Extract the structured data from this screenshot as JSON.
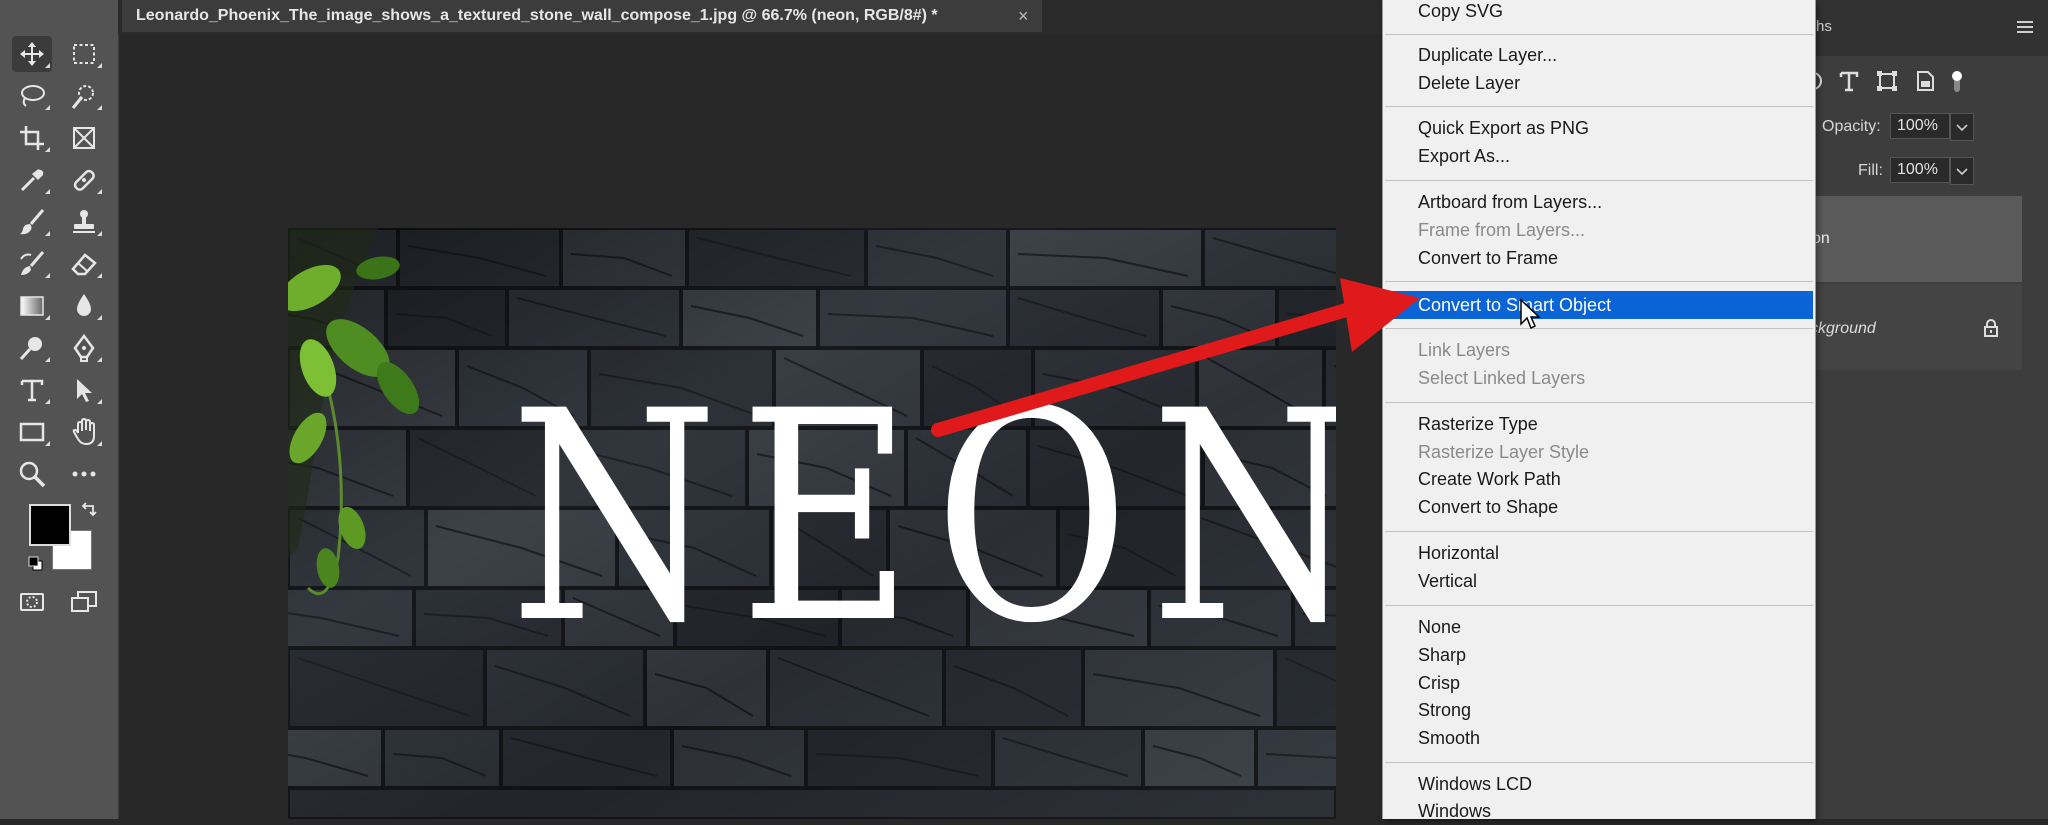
{
  "document": {
    "title": "Leonardo_Phoenix_The_image_shows_a_textured_stone_wall_compose_1.jpg @ 66.7% (neon, RGB/8#) *",
    "close_glyph": "×"
  },
  "canvas": {
    "text": "NEON"
  },
  "tools": [
    {
      "name": "move-tool-icon"
    },
    {
      "name": "marquee-tool-icon"
    },
    {
      "name": "lasso-tool-icon"
    },
    {
      "name": "quick-selection-tool-icon"
    },
    {
      "name": "crop-tool-icon"
    },
    {
      "name": "frame-tool-icon"
    },
    {
      "name": "eyedropper-tool-icon"
    },
    {
      "name": "healing-brush-tool-icon"
    },
    {
      "name": "brush-tool-icon"
    },
    {
      "name": "stamp-tool-icon"
    },
    {
      "name": "history-brush-tool-icon"
    },
    {
      "name": "eraser-tool-icon"
    },
    {
      "name": "gradient-tool-icon"
    },
    {
      "name": "blur-tool-icon"
    },
    {
      "name": "dodge-tool-icon"
    },
    {
      "name": "pen-tool-icon"
    },
    {
      "name": "type-tool-icon"
    },
    {
      "name": "path-selection-tool-icon"
    },
    {
      "name": "rectangle-tool-icon"
    },
    {
      "name": "hand-tool-icon"
    },
    {
      "name": "zoom-tool-icon"
    },
    {
      "name": "more-tools-icon"
    },
    {
      "name": "quick-mask-icon"
    },
    {
      "name": "screen-mode-icon"
    }
  ],
  "colors": {
    "foreground": "#000000",
    "background": "#ffffff",
    "menu_highlight": "#0a64d6",
    "arrow": "#e0191b"
  },
  "context_menu": {
    "items": [
      {
        "label": "Copy SVG",
        "disabled": false
      },
      {
        "label": "Duplicate Layer...",
        "disabled": false
      },
      {
        "label": "Delete Layer",
        "disabled": false
      },
      {
        "label": "Quick Export as PNG",
        "disabled": false
      },
      {
        "label": "Export As...",
        "disabled": false
      },
      {
        "label": "Artboard from Layers...",
        "disabled": false
      },
      {
        "label": "Frame from Layers...",
        "disabled": true
      },
      {
        "label": "Convert to Frame",
        "disabled": false
      },
      {
        "label": "Convert to Smart Object",
        "disabled": false,
        "highlighted": true
      },
      {
        "label": "Link Layers",
        "disabled": true
      },
      {
        "label": "Select Linked Layers",
        "disabled": true
      },
      {
        "label": "Rasterize Type",
        "disabled": false
      },
      {
        "label": "Rasterize Layer Style",
        "disabled": true
      },
      {
        "label": "Create Work Path",
        "disabled": false
      },
      {
        "label": "Convert to Shape",
        "disabled": false
      },
      {
        "label": "Horizontal",
        "disabled": false
      },
      {
        "label": "Vertical",
        "disabled": false
      },
      {
        "label": "None",
        "disabled": false
      },
      {
        "label": "Sharp",
        "disabled": false
      },
      {
        "label": "Crisp",
        "disabled": false
      },
      {
        "label": "Strong",
        "disabled": false
      },
      {
        "label": "Smooth",
        "disabled": false
      },
      {
        "label": "Windows LCD",
        "disabled": false
      },
      {
        "label": "Windows",
        "disabled": false
      }
    ]
  },
  "layers_panel": {
    "tab_label": "hs",
    "opacity_label": "Opacity:",
    "opacity_value": "100%",
    "fill_label": "Fill:",
    "fill_value": "100%",
    "layers": [
      {
        "name": "on"
      },
      {
        "name": "ckground"
      }
    ]
  }
}
